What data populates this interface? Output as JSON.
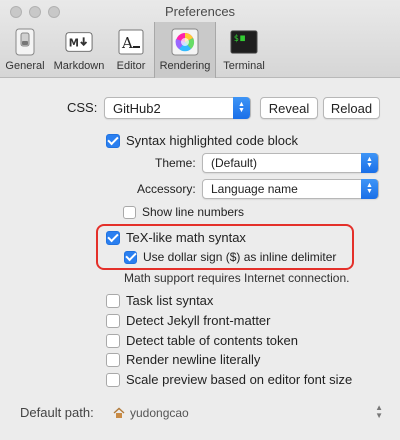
{
  "window": {
    "title": "Preferences"
  },
  "tabs": [
    {
      "label": "General",
      "icon": "general-switch-icon"
    },
    {
      "label": "Markdown",
      "icon": "markdown-icon"
    },
    {
      "label": "Editor",
      "icon": "editor-icon"
    },
    {
      "label": "Rendering",
      "icon": "color-wheel-icon",
      "selected": true
    },
    {
      "label": "Terminal",
      "icon": "terminal-icon"
    }
  ],
  "css": {
    "label": "CSS:",
    "value": "GitHub2",
    "reveal": "Reveal",
    "reload": "Reload"
  },
  "syntax": {
    "label": "Syntax highlighted code block",
    "checked": true,
    "theme_label": "Theme:",
    "theme_value": "(Default)",
    "accessory_label": "Accessory:",
    "accessory_value": "Language name",
    "line_numbers_label": "Show line numbers",
    "line_numbers_checked": false
  },
  "tex": {
    "label": "TeX-like math syntax",
    "checked": true,
    "dollar_label": "Use dollar sign ($) as inline delimiter",
    "dollar_checked": true,
    "note": "Math support requires Internet connection."
  },
  "options": [
    {
      "label": "Task list syntax",
      "checked": false
    },
    {
      "label": "Detect Jekyll front-matter",
      "checked": false
    },
    {
      "label": "Detect table of contents token",
      "checked": false
    },
    {
      "label": "Render newline literally",
      "checked": false
    },
    {
      "label": "Scale preview based on editor font size",
      "checked": false
    }
  ],
  "default_path": {
    "label": "Default path:",
    "value": "yudongcao",
    "icon": "home-icon"
  },
  "colors": {
    "accent": "#2a7ff0",
    "highlight": "#e4302a"
  }
}
